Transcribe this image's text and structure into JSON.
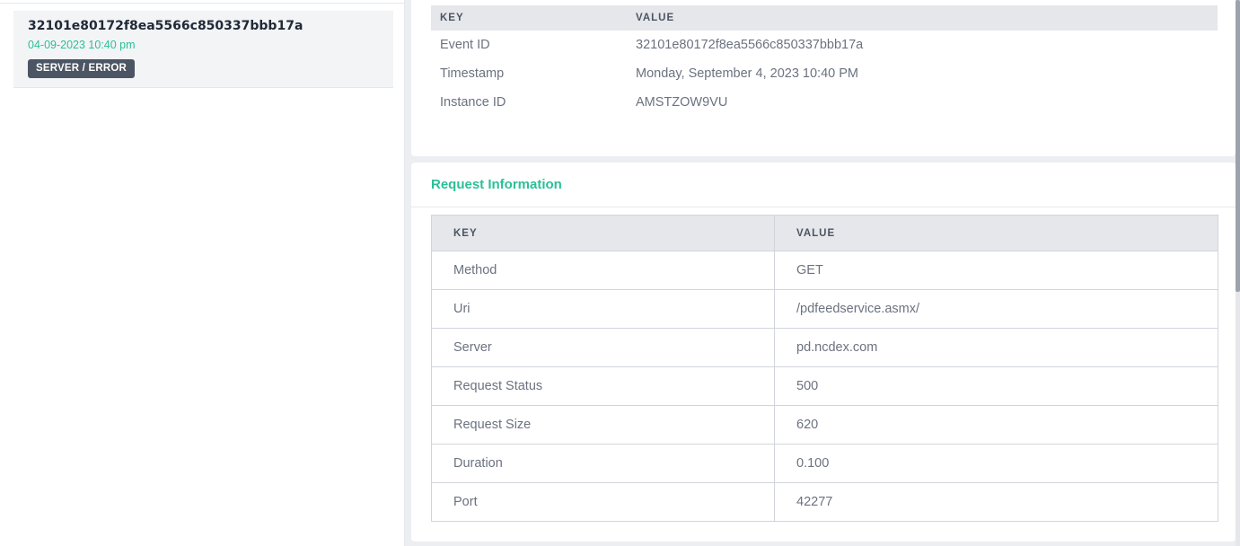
{
  "event_list": {
    "items": [
      {
        "id": "32101e80172f8ea5566c850337bbb17a",
        "time": "04-09-2023 10:40 pm",
        "badge": "SERVER / ERROR"
      }
    ]
  },
  "event_details": {
    "headers": {
      "key": "KEY",
      "value": "VALUE"
    },
    "rows": [
      {
        "key": "Event ID",
        "value": "32101e80172f8ea5566c850337bbb17a"
      },
      {
        "key": "Timestamp",
        "value": "Monday, September 4, 2023 10:40 PM"
      },
      {
        "key": "Instance ID",
        "value": "AMSTZOW9VU"
      }
    ]
  },
  "request_info": {
    "title": "Request Information",
    "headers": {
      "key": "KEY",
      "value": "VALUE"
    },
    "rows": [
      {
        "key": "Method",
        "value": "GET"
      },
      {
        "key": "Uri",
        "value": "/pdfeedservice.asmx/"
      },
      {
        "key": "Server",
        "value": "pd.ncdex.com"
      },
      {
        "key": "Request Status",
        "value": "500"
      },
      {
        "key": "Request Size",
        "value": "620"
      },
      {
        "key": "Duration",
        "value": "0.100"
      },
      {
        "key": "Port",
        "value": "42277"
      }
    ]
  },
  "colors": {
    "accent": "#2bbf97",
    "badge_bg": "#4b5563"
  }
}
